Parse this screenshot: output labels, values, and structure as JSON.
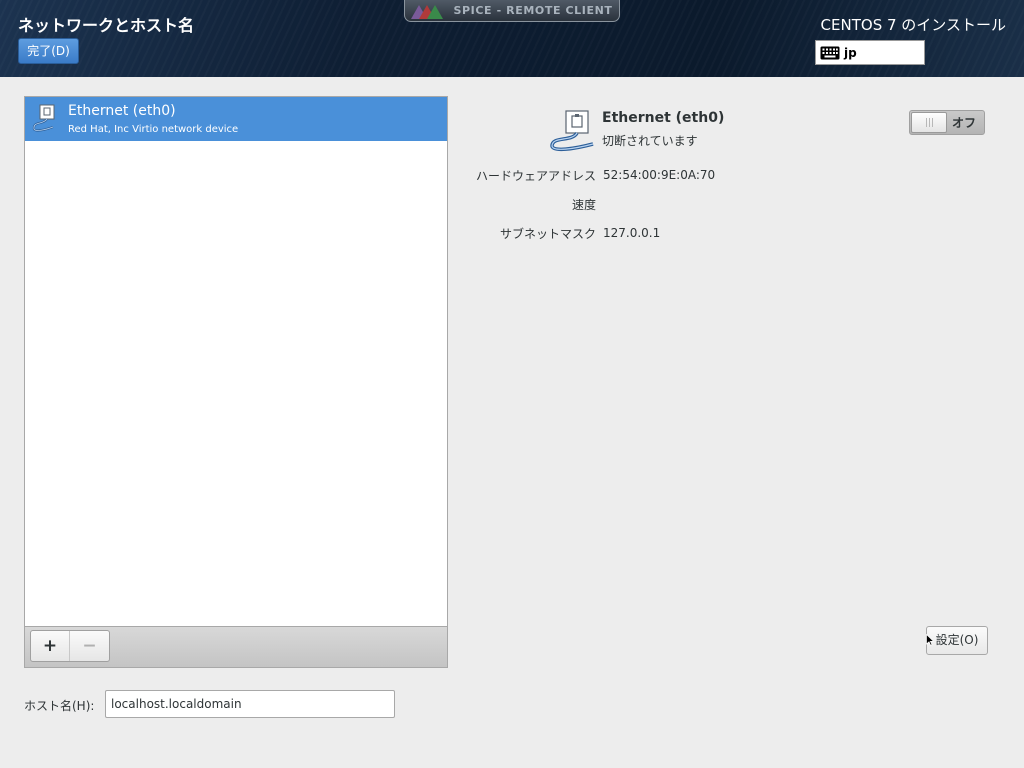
{
  "header": {
    "title": "ネットワークとホスト名",
    "done_label": "完了(D)",
    "spice_banner": "SPICE - REMOTE CLIENT",
    "install_title": "CENTOS 7 のインストール",
    "keyboard_layout": "jp"
  },
  "device_list": {
    "items": [
      {
        "name": "Ethernet (eth0)",
        "description": "Red Hat, Inc Virtio network device",
        "selected": true
      }
    ],
    "add_label": "+",
    "remove_label": "−"
  },
  "hostname": {
    "label": "ホスト名(H):",
    "value": "localhost.localdomain"
  },
  "details": {
    "name": "Ethernet (eth0)",
    "status": "切断されています",
    "toggle_label": "オフ",
    "toggle_on": false,
    "hardware_address_label": "ハードウェアアドレス",
    "hardware_address": "52:54:00:9E:0A:70",
    "speed_label": "速度",
    "speed": "",
    "subnet_mask_label": "サブネットマスク",
    "subnet_mask": "127.0.0.1",
    "settings_label": "設定(O)"
  },
  "colors": {
    "accent": "#4a90d9",
    "header_bg": "#0e1e33",
    "background": "#ededed"
  },
  "icons": {
    "device": "network-wired-icon",
    "keyboard": "keyboard-icon",
    "spice": "spice-logo-icon"
  }
}
